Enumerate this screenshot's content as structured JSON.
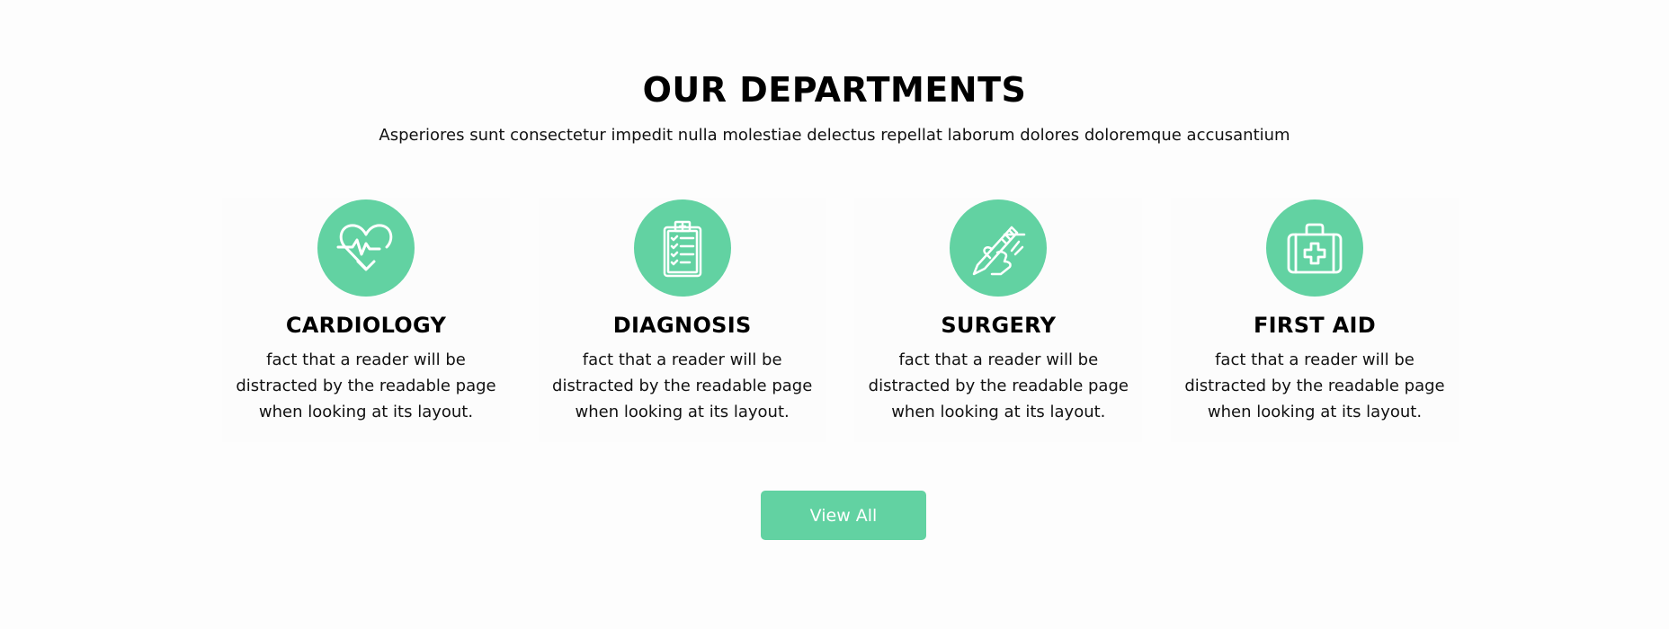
{
  "header": {
    "title": "OUR DEPARTMENTS",
    "subtitle": "Asperiores sunt consectetur impedit nulla molestiae delectus repellat laborum dolores doloremque accusantium"
  },
  "departments": [
    {
      "icon": "heartbeat-icon",
      "title": "CARDIOLOGY",
      "text": "fact that a reader will be distracted by the readable page when looking at its layout."
    },
    {
      "icon": "clipboard-checklist-icon",
      "title": "DIAGNOSIS",
      "text": "fact that a reader will be distracted by the readable page when looking at its layout."
    },
    {
      "icon": "scalpel-hand-icon",
      "title": "SURGERY",
      "text": "fact that a reader will be distracted by the readable page when looking at its layout."
    },
    {
      "icon": "first-aid-kit-icon",
      "title": "FIRST AID",
      "text": "fact that a reader will be distracted by the readable page when looking at its layout."
    }
  ],
  "actions": {
    "view_all_label": "View All"
  },
  "colors": {
    "accent": "#62d2a2",
    "background": "#fdfdfd",
    "text": "#111111"
  }
}
